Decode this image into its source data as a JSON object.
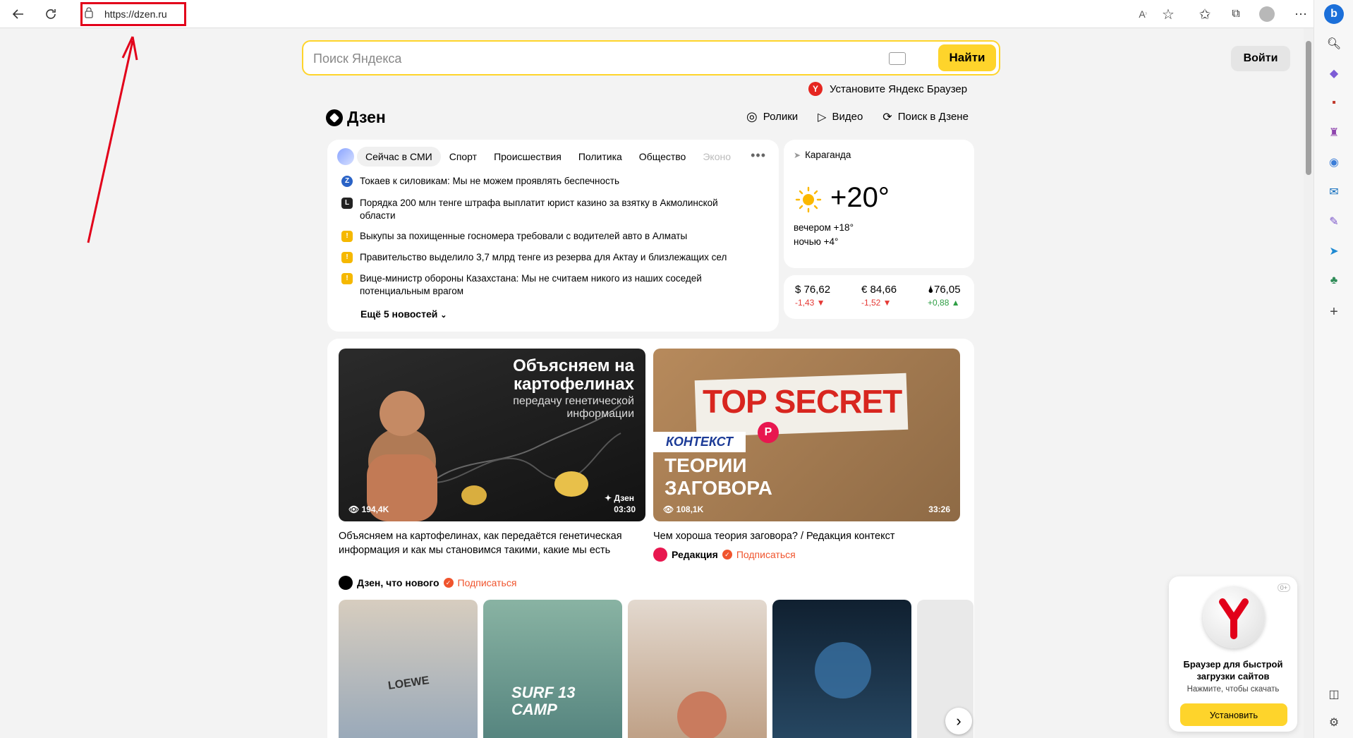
{
  "browser": {
    "url": "https://dzen.ru",
    "back_icon": "arrow-left-icon",
    "reload_icon": "reload-icon"
  },
  "search": {
    "placeholder": "Поиск Яндекса",
    "button": "Найти"
  },
  "login_button": "Войти",
  "browser_promo_line": "Установите Яндекс Браузер",
  "dzen": {
    "logo": "Дзен",
    "nav": [
      "Ролики",
      "Видео",
      "Поиск в Дзене"
    ]
  },
  "news": {
    "tabs": [
      "Сейчас в СМИ",
      "Спорт",
      "Происшествия",
      "Политика",
      "Общество",
      "Эконо"
    ],
    "items": [
      {
        "icon": "Z",
        "icon_color": "#2a63c6",
        "text": "Токаев к силовикам: Мы не можем проявлять беспечность"
      },
      {
        "icon": "L",
        "icon_color": "#222222",
        "text": "Порядка 200 млн тенге штрафа выплатит юрист казино за взятку в Акмолинской области"
      },
      {
        "icon": "!",
        "icon_color": "#f5b800",
        "text": "Выкупы за похищенные госномера требовали с водителей авто в Алматы"
      },
      {
        "icon": "!",
        "icon_color": "#f5b800",
        "text": "Правительство выделило 3,7 млрд тенге из резерва для Актау и близлежащих сел"
      },
      {
        "icon": "!",
        "icon_color": "#f5b800",
        "text": "Вице-министр обороны Казахстана: Мы не считаем никого из наших соседей потенциальным врагом"
      }
    ],
    "more": "Ещё 5 новостей"
  },
  "weather": {
    "city": "Караганда",
    "temp": "+20°",
    "evening": "вечером +18°",
    "night": "ночью +4°"
  },
  "rates": [
    {
      "value": "$ 76,62",
      "delta": "-1,43 ▼",
      "dir": "neg"
    },
    {
      "value": "€ 84,66",
      "delta": "-1,52 ▼",
      "dir": "neg"
    },
    {
      "value": "🌢76,05",
      "delta": "+0,88 ▲",
      "dir": "pos"
    }
  ],
  "videos": [
    {
      "overlay_title": "Объясняем на картофелинах",
      "overlay_sub": "передачу генетической информации",
      "views": "194,4K",
      "duration": "03:30",
      "brand": "Дзен",
      "title": "Объясняем на картофелинах, как передаётся генетическая информация и как мы становимся такими, какие мы есть",
      "channel": "Дзен, что нового",
      "subscribe": "Подписаться"
    },
    {
      "overlay_top": "TOP SECRET",
      "overlay_badge": "КОНТЕКСТ",
      "overlay_title": "ТЕОРИИ ЗАГОВОРА",
      "views": "108,1K",
      "duration": "33:26",
      "title": "Чем хороша теория заговора? / Редакция контекст",
      "channel": "Редакция",
      "subscribe": "Подписаться"
    }
  ],
  "shorts_text": [
    "LOEWE",
    "SURF 13 CAMP"
  ],
  "promo": {
    "age": "0+",
    "title": "Браузер для быстрой загрузки сайтов",
    "sub": "Нажмите, чтобы скачать",
    "button": "Установить"
  },
  "colors": {
    "accent_yellow": "#fed42b",
    "annotation_red": "#e2001a",
    "subscribe_orange": "#f0542d"
  }
}
